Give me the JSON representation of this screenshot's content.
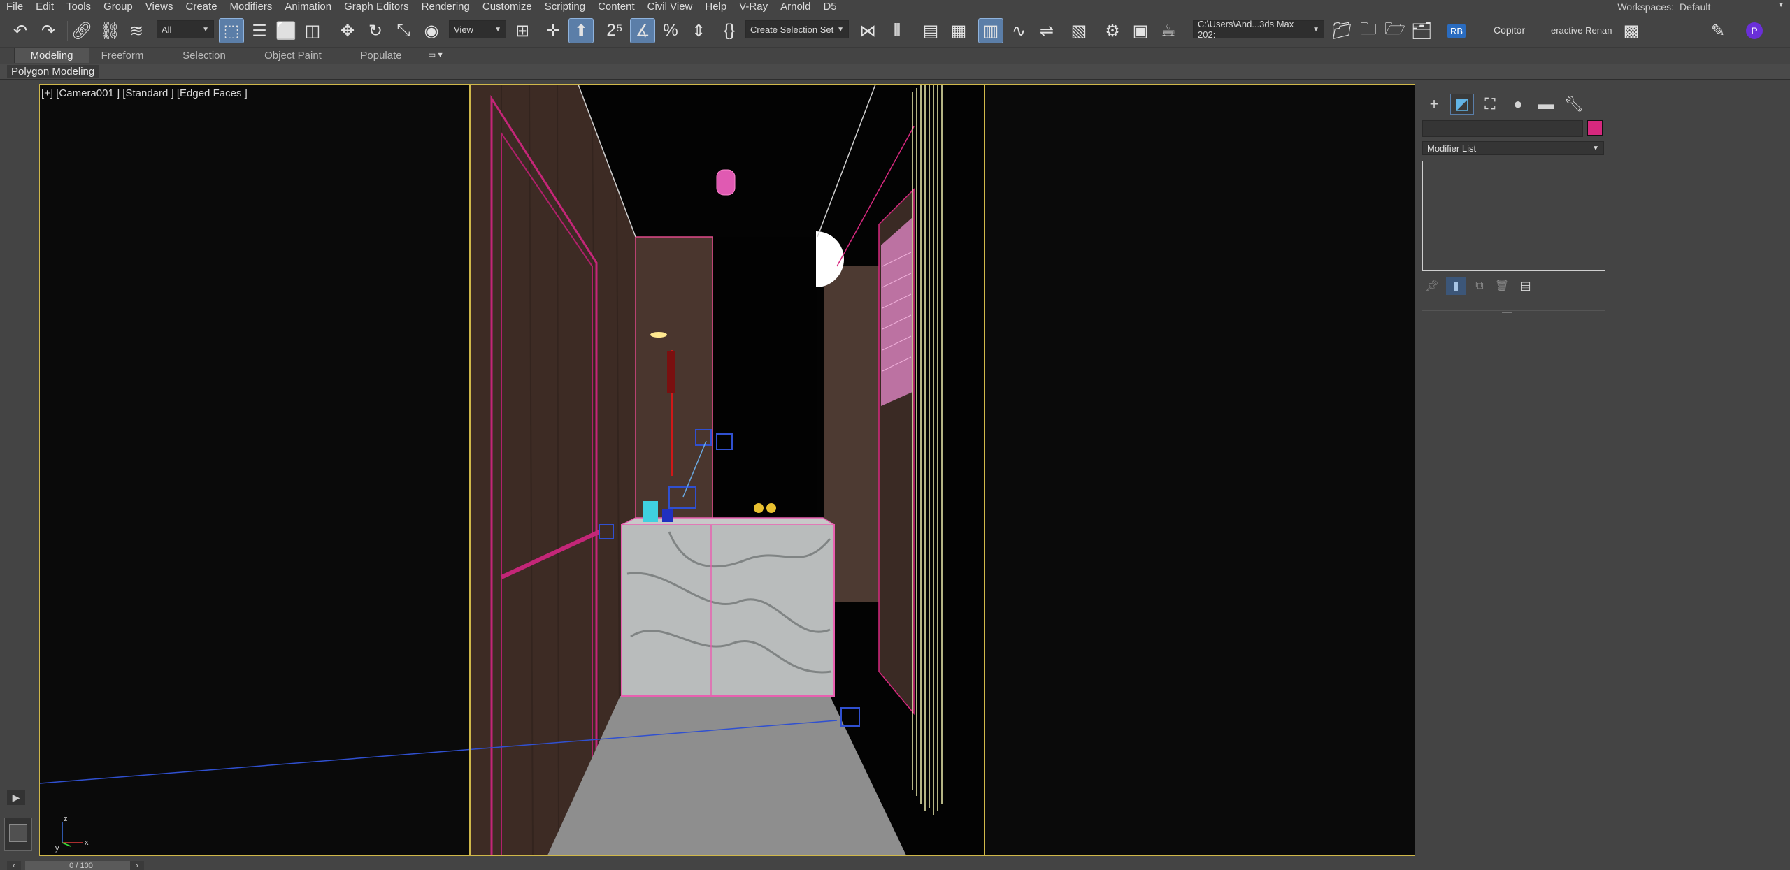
{
  "menu": [
    "File",
    "Edit",
    "Tools",
    "Group",
    "Views",
    "Create",
    "Modifiers",
    "Animation",
    "Graph Editors",
    "Rendering",
    "Customize",
    "Scripting",
    "Content",
    "Civil View",
    "Help",
    "V-Ray",
    "Arnold",
    "D5"
  ],
  "workspace": {
    "label": "Workspaces:",
    "value": "Default"
  },
  "toolbar": {
    "selection_filter": "All",
    "reference_coord": "View",
    "named_selection": "Create Selection Set",
    "project_path": "C:\\Users\\And...3ds Max 202:",
    "rb_label": "RB",
    "copitor_label": "Copitor",
    "interactive_label": "eractive Renan"
  },
  "ribbon": {
    "tabs": [
      "Modeling",
      "Freeform",
      "Selection",
      "Object Paint",
      "Populate"
    ],
    "active_tab": "Modeling",
    "panel_label": "Polygon Modeling"
  },
  "viewport": {
    "label": "[+] [Camera001 ] [Standard ] [Edged Faces ]",
    "axis_z": "z",
    "axis_x": "x",
    "axis_y": "y"
  },
  "command_panel": {
    "tabs": [
      "create",
      "modify",
      "hierarchy",
      "motion",
      "display",
      "utilities"
    ],
    "active_tab": "modify",
    "modifier_list": "Modifier List",
    "object_color": "#d6287e"
  },
  "timeline": {
    "frame": "0 / 100"
  },
  "colors": {
    "selection_border": "#d0b84a",
    "wire_magenta": "#d6287e",
    "active_blue": "#5b7ea8"
  }
}
